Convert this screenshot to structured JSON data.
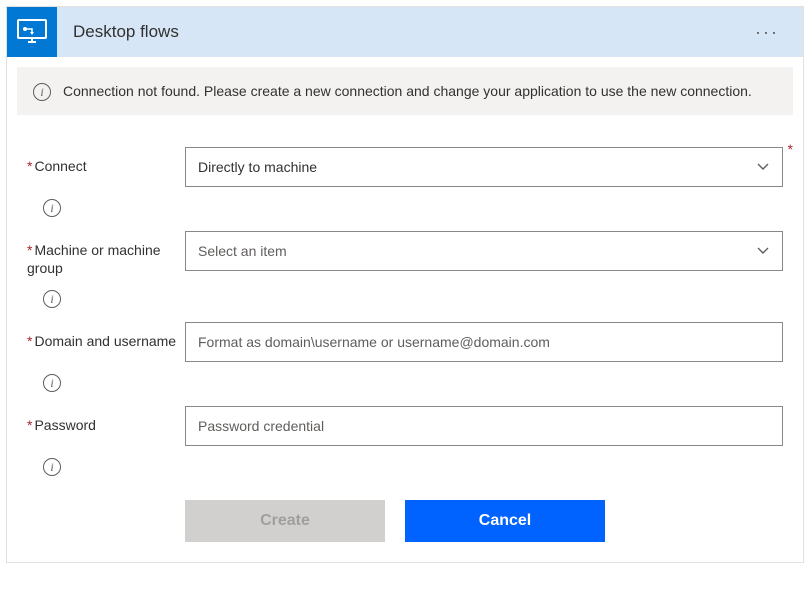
{
  "header": {
    "title": "Desktop flows"
  },
  "banner": {
    "message": "Connection not found. Please create a new connection and change your application to use the new connection."
  },
  "fields": {
    "connect": {
      "label": "Connect",
      "value": "Directly to machine"
    },
    "machine": {
      "label": "Machine or machine group",
      "placeholder": "Select an item"
    },
    "domainUser": {
      "label": "Domain and username",
      "placeholder": "Format as domain\\username or username@domain.com"
    },
    "password": {
      "label": "Password",
      "placeholder": "Password credential"
    }
  },
  "buttons": {
    "create": "Create",
    "cancel": "Cancel"
  }
}
